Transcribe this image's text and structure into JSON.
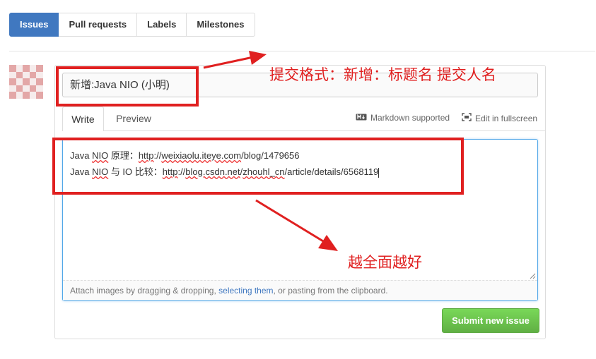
{
  "nav": {
    "tabs": [
      {
        "label": "Issues",
        "selected": true
      },
      {
        "label": "Pull requests",
        "selected": false
      },
      {
        "label": "Labels",
        "selected": false
      },
      {
        "label": "Milestones",
        "selected": false
      }
    ]
  },
  "issue_form": {
    "title_value": "新增:Java NIO (小明)",
    "tabs": {
      "write": "Write",
      "preview": "Preview"
    },
    "markdown_hint": "Markdown supported",
    "fullscreen_hint": "Edit in fullscreen",
    "body_lines": [
      {
        "parts": [
          "Java ",
          "NIO",
          " 原理：",
          "http",
          "://",
          "weixiaolu.iteye.com",
          "/blog/1479656"
        ]
      },
      {
        "parts": [
          "Java ",
          "NIO",
          " 与 IO 比较：",
          "http",
          "://",
          "blog.csdn.net",
          "/",
          "zhouhl_cn",
          "/article/details/6568119"
        ]
      }
    ],
    "attach_hint": {
      "before": "Attach images by dragging & dropping, ",
      "link": "selecting them",
      "after": ", or pasting from the clipboard."
    },
    "submit_label": "Submit new issue"
  },
  "annotations": {
    "format_note": "提交格式：新增：标题名 提交人名",
    "detail_note": "越全面越好",
    "color": "#e02020"
  },
  "colors": {
    "selected_tab": "#4078c0",
    "submit_button": "#60b044",
    "focus_border": "#51a7e8",
    "link": "#4078c0"
  }
}
